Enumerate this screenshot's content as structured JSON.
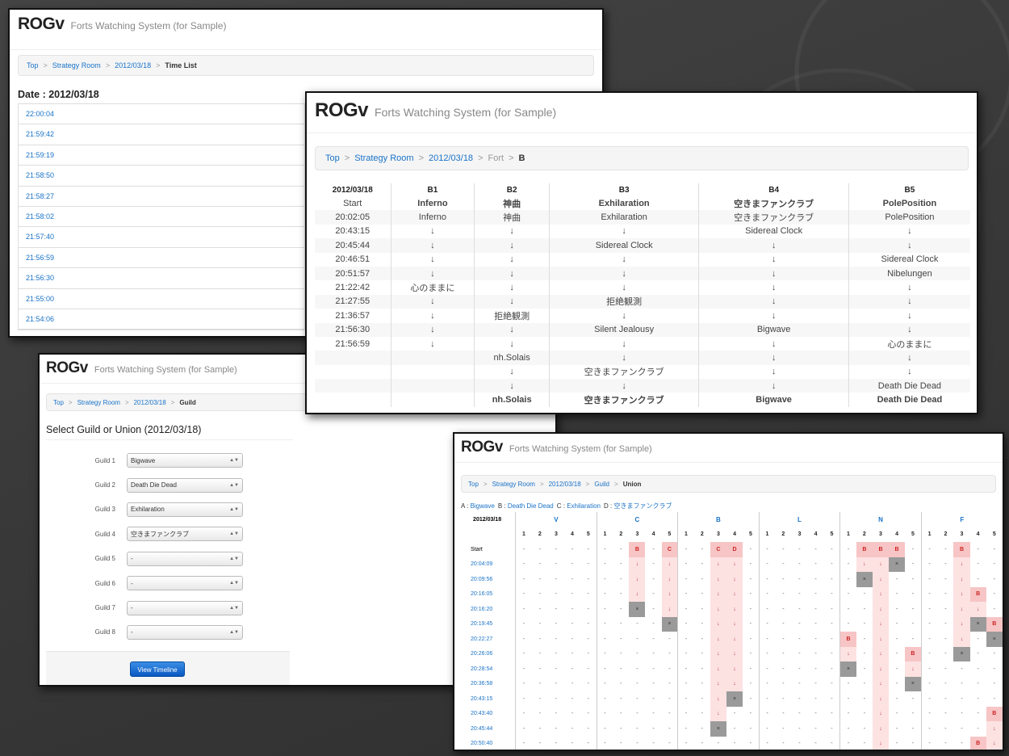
{
  "time_list": {
    "logo": "ROGv",
    "subtitle": "Forts Watching System (for Sample)",
    "breadcrumb": [
      "Top",
      "Strategy Room",
      "2012/03/18"
    ],
    "breadcrumb_current": "Time List",
    "date_label": "Date : 2012/03/18",
    "times": [
      "22:00:04",
      "21:59:42",
      "21:59:19",
      "21:58:50",
      "21:58:27",
      "21:58:02",
      "21:57:40",
      "21:56:59",
      "21:56:30",
      "21:55:00",
      "21:54:06"
    ]
  },
  "fort_view": {
    "logo": "ROGv",
    "subtitle": "Forts Watching System (for Sample)",
    "breadcrumb": [
      "Top",
      "Strategy Room",
      "2012/03/18"
    ],
    "breadcrumb_plain": "Fort",
    "breadcrumb_current": "B",
    "columns": [
      "2012/03/18",
      "B1",
      "B2",
      "B3",
      "B4",
      "B5"
    ],
    "rows": [
      [
        "Start",
        "Inferno",
        "神曲",
        "Exhilaration",
        "空きまファンクラブ",
        "PolePosition"
      ],
      [
        "20:02:05",
        "Inferno",
        "神曲",
        "Exhilaration",
        "空きまファンクラブ",
        "PolePosition"
      ],
      [
        "20:43:15",
        "↓",
        "↓",
        "↓",
        "Sidereal Clock",
        "↓"
      ],
      [
        "20:45:44",
        "↓",
        "↓",
        "Sidereal Clock",
        "↓",
        "↓"
      ],
      [
        "20:46:51",
        "↓",
        "↓",
        "↓",
        "↓",
        "Sidereal Clock"
      ],
      [
        "20:51:57",
        "↓",
        "↓",
        "↓",
        "↓",
        "Nibelungen"
      ],
      [
        "21:22:42",
        "心のままに",
        "↓",
        "↓",
        "↓",
        "↓"
      ],
      [
        "21:27:55",
        "↓",
        "↓",
        "拒絶観測",
        "↓",
        "↓"
      ],
      [
        "21:36:57",
        "↓",
        "拒絶観測",
        "↓",
        "↓",
        "↓"
      ],
      [
        "21:56:30",
        "↓",
        "↓",
        "Silent Jealousy",
        "Bigwave",
        "↓"
      ],
      [
        "21:56:59",
        "↓",
        "↓",
        "↓",
        "↓",
        "心のままに"
      ],
      [
        "",
        "",
        "nh.Solais",
        "↓",
        "↓",
        "↓"
      ],
      [
        "",
        "",
        "↓",
        "空きまファンクラブ",
        "↓",
        "↓"
      ],
      [
        "",
        "",
        "↓",
        "↓",
        "↓",
        "Death Die Dead"
      ],
      [
        "",
        "",
        "nh.Solais",
        "空きまファンクラブ",
        "Bigwave",
        "Death Die Dead"
      ]
    ]
  },
  "guild_select": {
    "logo": "ROGv",
    "subtitle": "Forts Watching System (for Sample)",
    "breadcrumb": [
      "Top",
      "Strategy Room",
      "2012/03/18"
    ],
    "breadcrumb_current": "Guild",
    "title": "Select Guild or Union (2012/03/18)",
    "guilds": [
      {
        "label": "Guild 1",
        "value": "Bigwave"
      },
      {
        "label": "Guild 2",
        "value": "Death Die Dead"
      },
      {
        "label": "Guild 3",
        "value": "Exhilaration"
      },
      {
        "label": "Guild 4",
        "value": "空きまファンクラブ"
      },
      {
        "label": "Guild 5",
        "value": "-"
      },
      {
        "label": "Guild 6",
        "value": "-"
      },
      {
        "label": "Guild 7",
        "value": "-"
      },
      {
        "label": "Guild 8",
        "value": "-"
      }
    ],
    "button": "View Timeline"
  },
  "union_view": {
    "logo": "ROGv",
    "subtitle": "Forts Watching System (for Sample)",
    "breadcrumb": [
      "Top",
      "Strategy Room",
      "2012/03/18",
      "Guild"
    ],
    "breadcrumb_current": "Union",
    "legend": [
      {
        "key": "A :",
        "name": "Bigwave"
      },
      {
        "key": "B :",
        "name": "Death Die Dead"
      },
      {
        "key": "C :",
        "name": "Exhilaration"
      },
      {
        "key": "D :",
        "name": "空きまファンクラブ"
      }
    ],
    "date_header": "2012/03/18",
    "forts": [
      "V",
      "C",
      "B",
      "L",
      "N",
      "F"
    ],
    "fort_numbers": [
      "1",
      "2",
      "3",
      "4",
      "5"
    ],
    "times": [
      "Start",
      "20:04:09",
      "20:09:56",
      "20:16:05",
      "20:16:20",
      "20:19:45",
      "20:22:27",
      "20:26:06",
      "20:28:54",
      "20:36:58",
      "20:43:15",
      "20:43:40",
      "20:45:44",
      "20:50:40"
    ],
    "grid": [
      "-----|--B-C|--CD-|-----|-BBB-|--B--",
      "-----|--↓-↓|--↓↓-|-----|-↓↓x-|--↓--",
      "-----|--↓-↓|--↓↓-|-----|-x↓--|--↓--",
      "-----|--↓-↓|--↓↓-|-----|--↓--|--↓B-",
      "-----|--x-↓|--↓↓-|-----|--↓--|--↓↓-",
      "-----|----x|--↓↓-|-----|--↓--|--↓xB",
      "-----|-----|--↓↓-|-----|B-↓--|--↓-x",
      "-----|-----|--↓↓-|-----|↓-↓-B|--x--",
      "-----|-----|--↓↓-|-----|x-↓-↓|-----",
      "-----|-----|--↓↓-|-----|--↓-x|-----",
      "-----|-----|--↓x-|-----|--↓--|-----",
      "-----|-----|--↓--|-----|--↓--|----B",
      "-----|-----|--x--|-----|--↓--|----↓",
      "-----|-----|-----|-----|--↓--|---B↓"
    ]
  }
}
